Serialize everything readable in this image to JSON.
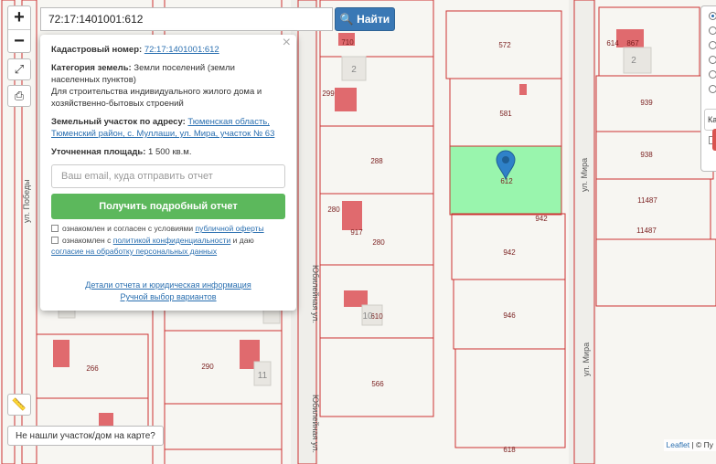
{
  "search": {
    "value": "72:17:1401001:612",
    "button_label": "Найти"
  },
  "zoom": {
    "in": "+",
    "out": "−"
  },
  "popup": {
    "cadastral_label": "Кадастровый номер:",
    "cadastral_value": "72:17:1401001:612",
    "category_label": "Категория земель:",
    "category_value": "Земли поселений (земли населенных пунктов)",
    "usage_text": "Для строительства индивидуального жилого дома и хозяйственно-бытовых строений",
    "address_label": "Земельный участок по адресу:",
    "address_value": "Тюменская область, Тюменский район, с. Муллаши, ул. Мира, участок № 63",
    "area_label": "Уточненная площадь:",
    "area_value": "1 500 кв.м.",
    "email_placeholder": "Ваш email, куда отправить отчет",
    "report_button": "Получить подробный отчет",
    "check1_prefix": "ознакомлен и согласен с условиями",
    "check1_link": "публичной оферты",
    "check2_prefix": "ознакомлен с",
    "check2_link": "политикой конфиденциальности",
    "check2_mid": "и даю",
    "check2_link2": "согласие на обработку персональных данных",
    "details_link": "Детали отчета и юридическая информация",
    "manual_link": "Ручной выбор вариантов",
    "close": "×"
  },
  "right_panel": {
    "text": "Ка"
  },
  "bottom_button": "Не нашли участок/дом на карте?",
  "attribution": {
    "leaflet": "Leaflet",
    "rest": "| © Пу"
  },
  "map": {
    "streets": [
      "ул. Победы",
      "Юбилейная ул.",
      "ул. Мира",
      "ул. Мира",
      "Юбилейная ул."
    ],
    "parcel_labels": [
      "710",
      "572",
      "614",
      "867",
      "939",
      "299",
      "581",
      "288",
      "938",
      "612",
      "942",
      "11487",
      "280",
      "917",
      "280",
      "942",
      "11487",
      "610",
      "946",
      "266",
      "290",
      "566",
      "618"
    ],
    "building_labels": [
      "2",
      "2",
      "11",
      "10"
    ],
    "highlight_color": "#99f5ad",
    "line_color": "#cc3333",
    "marker_color": "#2f81c8"
  }
}
